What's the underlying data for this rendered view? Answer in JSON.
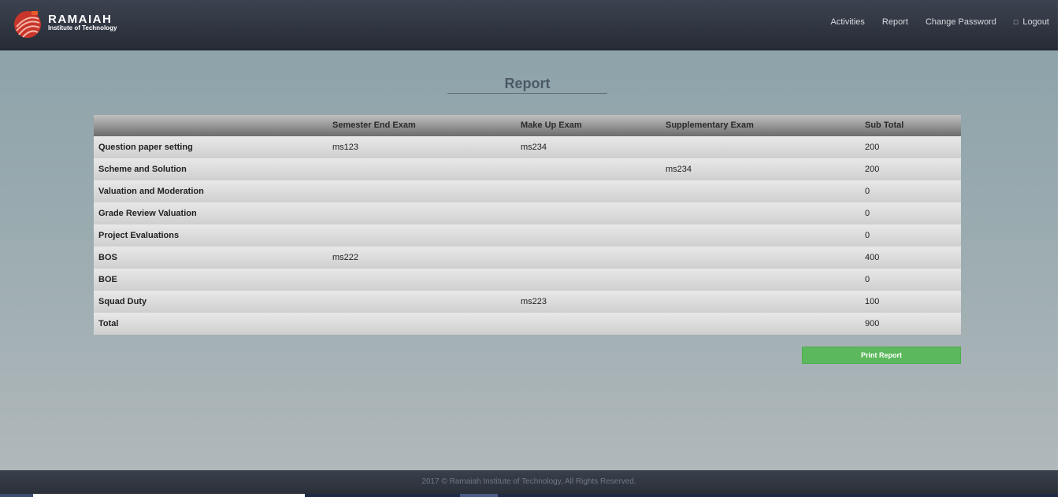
{
  "brand": {
    "name": "RAMAIAH",
    "subtitle": "Institute of Technology"
  },
  "nav": {
    "activities": "Activities",
    "report": "Report",
    "change_password": "Change Password",
    "logout_icon": "□",
    "logout": "Logout"
  },
  "page": {
    "title": "Report"
  },
  "table": {
    "headers": [
      "",
      "Semester End Exam",
      "Make Up Exam",
      "Supplementary Exam",
      "Sub Total"
    ],
    "rows": [
      [
        "Question paper setting",
        "ms123",
        "ms234",
        "",
        "200"
      ],
      [
        "Scheme and Solution",
        "",
        "",
        "ms234",
        "200"
      ],
      [
        "Valuation and Moderation",
        "",
        "",
        "",
        "0"
      ],
      [
        "Grade Review Valuation",
        "",
        "",
        "",
        "0"
      ],
      [
        "Project Evaluations",
        "",
        "",
        "",
        "0"
      ],
      [
        "BOS",
        "ms222",
        "",
        "",
        "400"
      ],
      [
        "BOE",
        "",
        "",
        "",
        "0"
      ],
      [
        "Squad Duty",
        "",
        "ms223",
        "",
        "100"
      ],
      [
        "Total",
        "",
        "",
        "",
        "900"
      ]
    ]
  },
  "actions": {
    "print": "Print Report"
  },
  "footer": {
    "text": "2017 © Ramaiah Institute of Technology, All Rights Reserved."
  },
  "colors": {
    "accent": "#5cb85c",
    "header_bg": "#262b35",
    "logo_red": "#d63a2a"
  }
}
